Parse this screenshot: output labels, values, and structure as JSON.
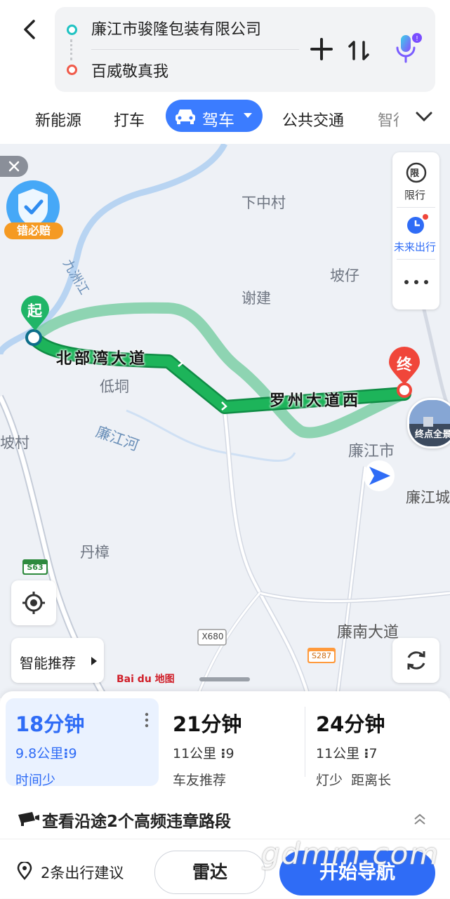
{
  "header": {
    "back_icon": "chevron-left-icon",
    "origin": "廉江市骏隆包装有限公司",
    "destination": "百威敬真我",
    "add_icon": "plus-icon",
    "swap_icon": "swap-icon",
    "voice_icon": "microphone-icon"
  },
  "tabs": {
    "items": [
      "新能源",
      "打车",
      "驾车",
      "公共交通",
      "智行"
    ],
    "active": "驾车",
    "more_icon": "chevron-down-icon"
  },
  "map": {
    "labels": {
      "xiazhongcun": "下中村",
      "pozai": "坡仔",
      "xiejian": "谢建",
      "dijiong": "低垌",
      "lianjianghe": "廉江河",
      "pocun": "坡村",
      "lianjiangshi": "廉江市",
      "danzhang": "丹樟",
      "lianjiangcheng": "廉江城",
      "liannan": "廉南大道",
      "jiuzhoujiang": "九洲江",
      "s63": "S63",
      "x680": "X680",
      "s287": "S287"
    },
    "route_labels": {
      "road1": "北部湾大道",
      "road2": "罗州大道西"
    },
    "start_marker": "起",
    "end_marker": "终",
    "badge": "错必赔",
    "endpoint_view": "终点全景",
    "restrict_label": "限行",
    "restrict_icon_text": "限",
    "future_label": "未来出行",
    "smart_recommend": "智能推荐",
    "baidu_logo": "Bai du 地图",
    "colors": {
      "route_main": "#1db45a",
      "route_alt": "#7ccfa6",
      "accent": "#3b7cff",
      "end_red": "#f0463a"
    }
  },
  "routes": [
    {
      "time": "18分钟",
      "distance": "9.8公里",
      "lights": "9",
      "tag": "时间少",
      "selected": true
    },
    {
      "time": "21分钟",
      "distance": "11公里",
      "lights": "9",
      "tag": "车友推荐",
      "selected": false
    },
    {
      "time": "24分钟",
      "distance": "11公里",
      "lights": "7",
      "tag": "灯少  距离长",
      "selected": false
    }
  ],
  "violation": {
    "text_pre": "查看沿途",
    "count": "2",
    "text_post": "个高频违章路段"
  },
  "bottom": {
    "suggest": "2条出行建议",
    "radar": "雷达",
    "start_nav": "开始导航"
  },
  "watermark": "gdmm.com"
}
